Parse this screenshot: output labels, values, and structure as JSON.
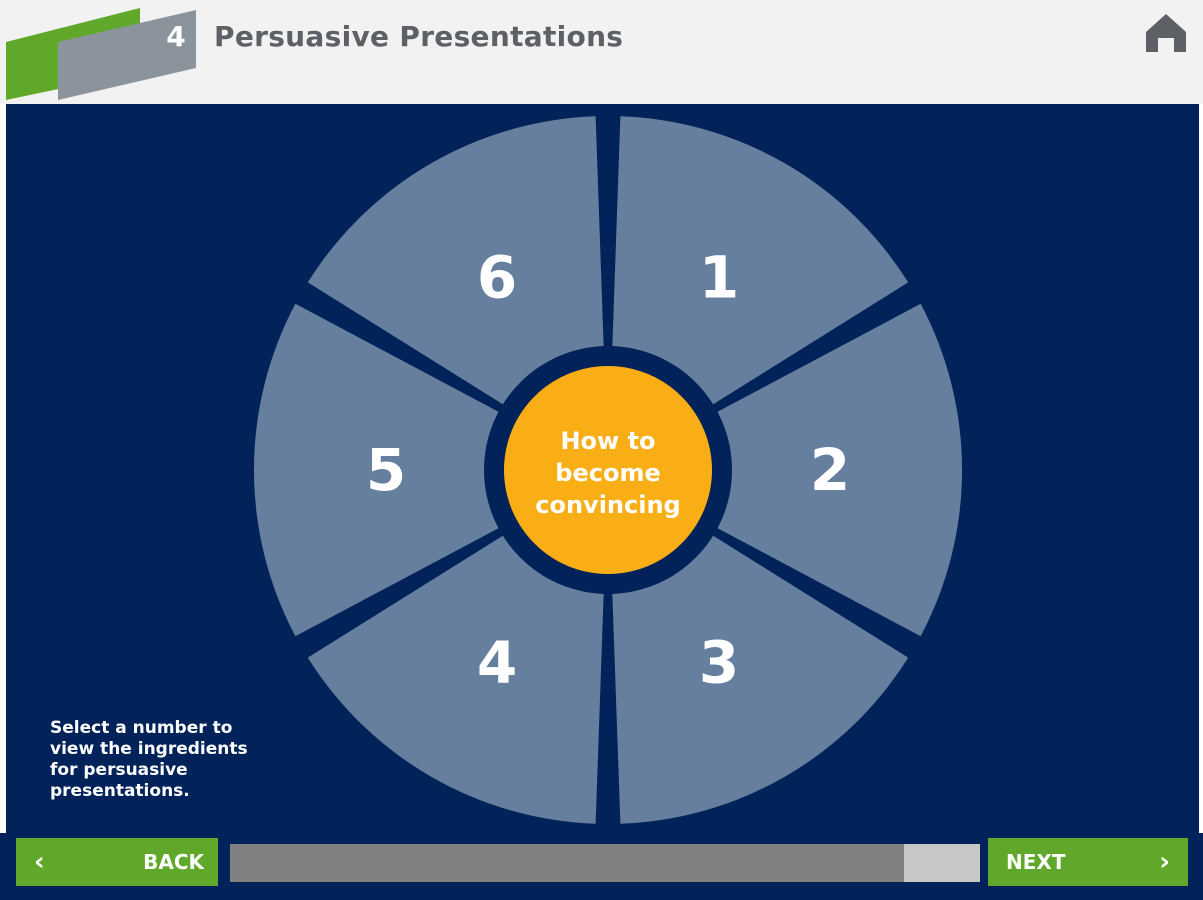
{
  "header": {
    "module_number": "4",
    "title": "Persuasive Presentations",
    "home_icon": "home-icon"
  },
  "colors": {
    "header_bg": "#f2f2f2",
    "accent_green": "#5fa82a",
    "badge_gray": "#8b949c",
    "main_bg": "#012359",
    "segment_fill": "#667f9e",
    "center_fill": "#f9ae16",
    "progress_track": "#c7c7c7",
    "progress_fill": "#808080"
  },
  "wheel": {
    "center_label": [
      "How to",
      "become",
      "convincing"
    ],
    "segments": [
      {
        "label": "1"
      },
      {
        "label": "2"
      },
      {
        "label": "3"
      },
      {
        "label": "4"
      },
      {
        "label": "5"
      },
      {
        "label": "6"
      }
    ]
  },
  "instructions": "Select a number to\nview the ingredients\nfor persuasive\npresentations.",
  "nav": {
    "back_label": "BACK",
    "next_label": "NEXT",
    "back_icon": "chevron-left-icon",
    "next_icon": "chevron-right-icon"
  },
  "progress": {
    "fraction": 0.898
  }
}
